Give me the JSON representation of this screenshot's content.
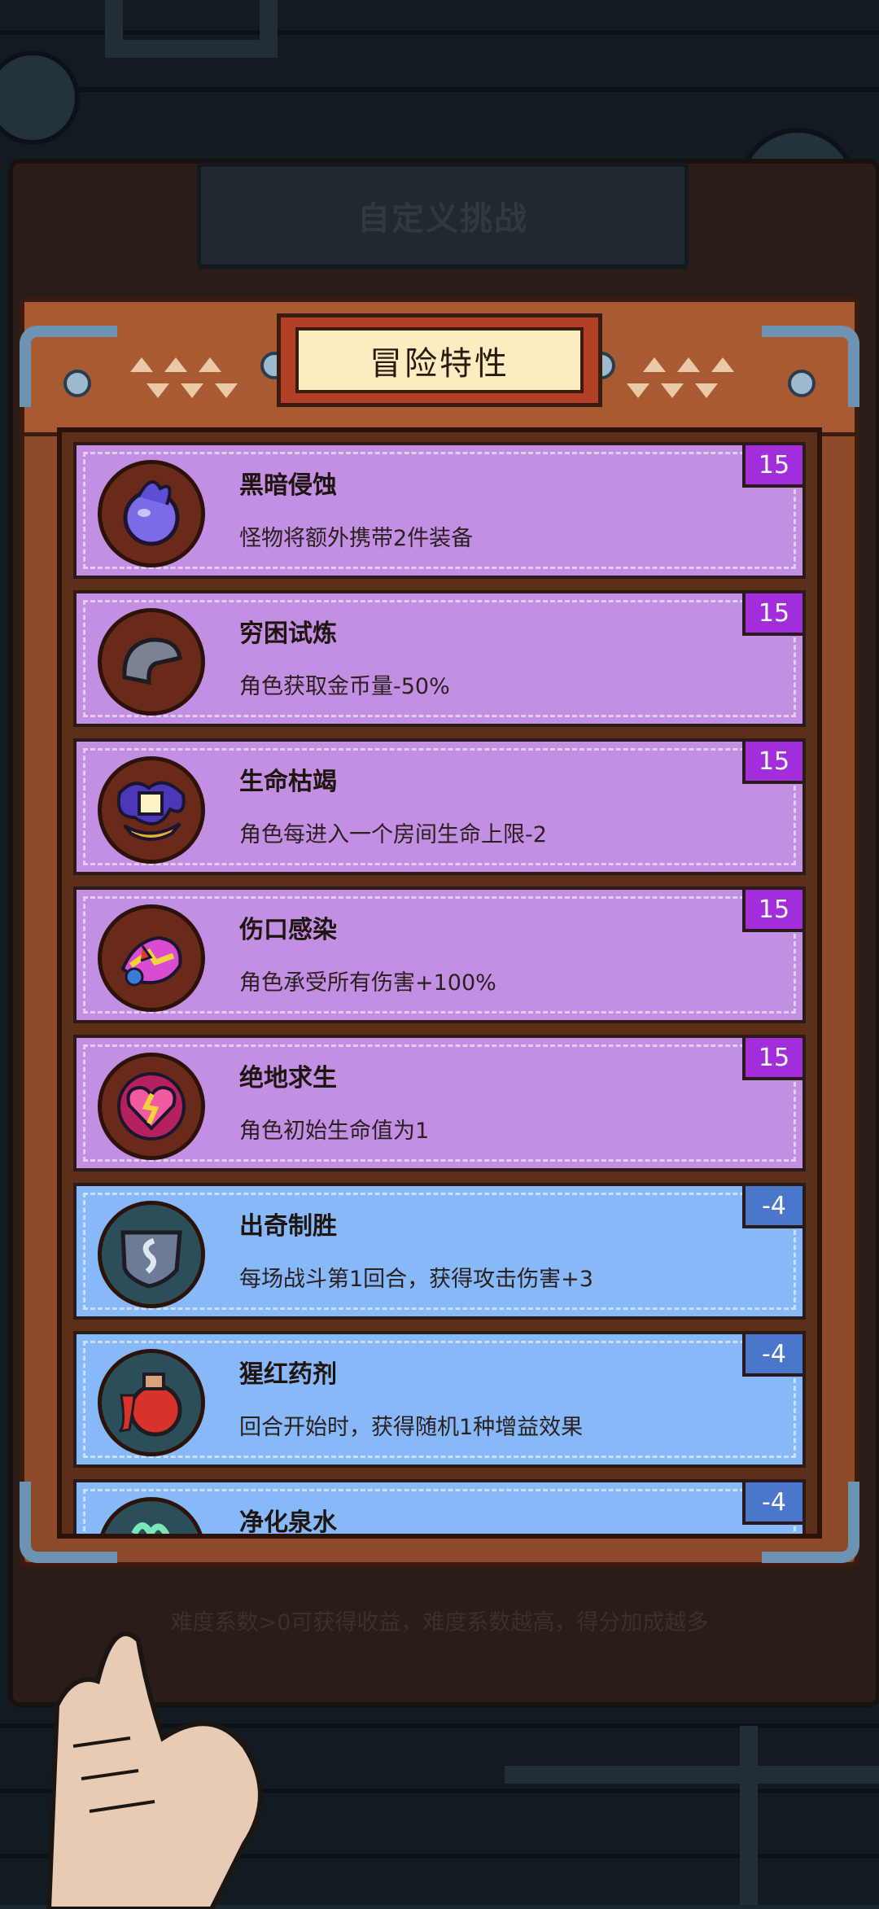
{
  "background_title": "自定义挑战",
  "background_hint": "难度系数>0可获得收益，难度系数越高，得分加成越多",
  "panel_title": "冒险特性",
  "colors": {
    "card_purple": "#c38fe3",
    "card_blue": "#87b8f7",
    "badge_purple": "#a22ddb",
    "badge_blue": "#4a76cc",
    "frame": "#8c4a2b"
  },
  "traits": [
    {
      "name": "黑暗侵蚀",
      "desc": "怪物将额外携带2件装备",
      "value": "15",
      "kind": "purple",
      "icon": "dark-orb-icon"
    },
    {
      "name": "穷困试炼",
      "desc": "角色获取金币量-50%",
      "value": "15",
      "kind": "purple",
      "icon": "empty-pouch-icon"
    },
    {
      "name": "生命枯竭",
      "desc": "角色每进入一个房间生命上限-2",
      "value": "15",
      "kind": "purple",
      "icon": "candle-lamp-icon"
    },
    {
      "name": "伤口感染",
      "desc": "角色承受所有伤害+100%",
      "value": "15",
      "kind": "purple",
      "icon": "wound-hand-icon"
    },
    {
      "name": "绝地求生",
      "desc": "角色初始生命值为1",
      "value": "15",
      "kind": "purple",
      "icon": "broken-heart-icon"
    },
    {
      "name": "出奇制胜",
      "desc": "每场战斗第1回合，获得攻击伤害+3",
      "value": "-4",
      "kind": "blue",
      "icon": "shield-icon"
    },
    {
      "name": "猩红药剂",
      "desc": "回合开始时，获得随机1种增益效果",
      "value": "-4",
      "kind": "blue",
      "icon": "red-potion-icon"
    },
    {
      "name": "净化泉水",
      "desc": "",
      "value": "-4",
      "kind": "blue",
      "icon": "spring-water-icon"
    }
  ]
}
